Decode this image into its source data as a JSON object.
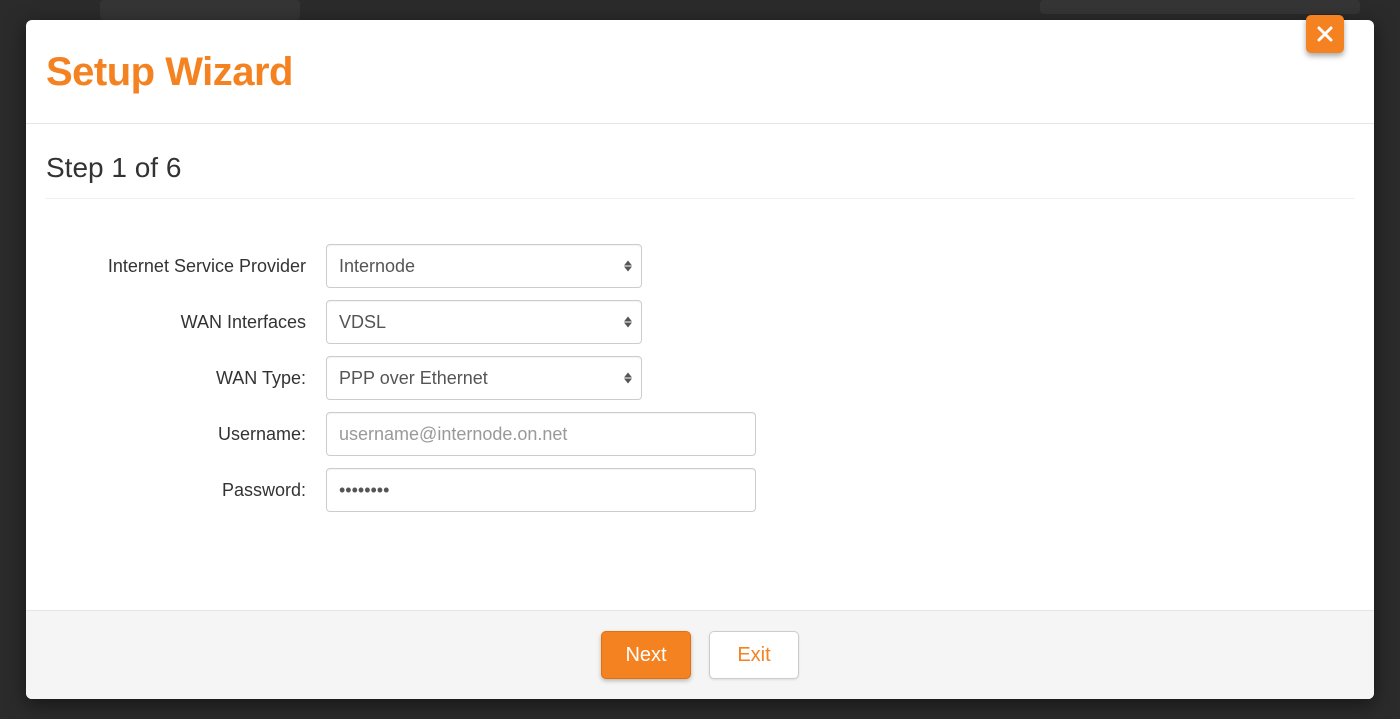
{
  "modal": {
    "title": "Setup Wizard",
    "step_heading": "Step 1 of 6",
    "close_icon": "close"
  },
  "form": {
    "isp": {
      "label": "Internet Service Provider",
      "value": "Internode"
    },
    "wan_interfaces": {
      "label": "WAN Interfaces",
      "value": "VDSL"
    },
    "wan_type": {
      "label": "WAN Type:",
      "value": "PPP over Ethernet"
    },
    "username": {
      "label": "Username:",
      "placeholder": "username@internode.on.net",
      "value": ""
    },
    "password": {
      "label": "Password:",
      "value": "••••••••"
    }
  },
  "footer": {
    "next_label": "Next",
    "exit_label": "Exit"
  },
  "colors": {
    "accent": "#f58220"
  }
}
